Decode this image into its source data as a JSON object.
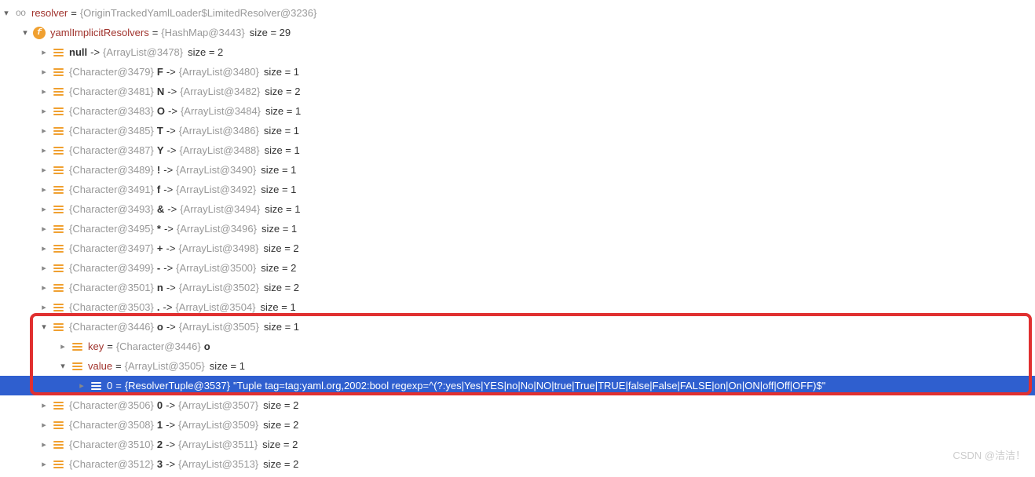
{
  "root": {
    "name": "resolver",
    "value": "{OriginTrackedYamlLoader$LimitedResolver@3236}"
  },
  "field": {
    "name": "yamlImplicitResolvers",
    "value": "{HashMap@3443}",
    "size": "size = 29"
  },
  "entries": [
    {
      "keyObj": "",
      "keyName": "null",
      "arrow": "->",
      "valObj": "{ArrayList@3478}",
      "size": "size = 2"
    },
    {
      "keyObj": "{Character@3479}",
      "keyName": "F",
      "arrow": "->",
      "valObj": "{ArrayList@3480}",
      "size": "size = 1"
    },
    {
      "keyObj": "{Character@3481}",
      "keyName": "N",
      "arrow": "->",
      "valObj": "{ArrayList@3482}",
      "size": "size = 2"
    },
    {
      "keyObj": "{Character@3483}",
      "keyName": "O",
      "arrow": "->",
      "valObj": "{ArrayList@3484}",
      "size": "size = 1"
    },
    {
      "keyObj": "{Character@3485}",
      "keyName": "T",
      "arrow": "->",
      "valObj": "{ArrayList@3486}",
      "size": "size = 1"
    },
    {
      "keyObj": "{Character@3487}",
      "keyName": "Y",
      "arrow": "->",
      "valObj": "{ArrayList@3488}",
      "size": "size = 1"
    },
    {
      "keyObj": "{Character@3489}",
      "keyName": "!",
      "arrow": "->",
      "valObj": "{ArrayList@3490}",
      "size": "size = 1"
    },
    {
      "keyObj": "{Character@3491}",
      "keyName": "f",
      "arrow": "->",
      "valObj": "{ArrayList@3492}",
      "size": "size = 1"
    },
    {
      "keyObj": "{Character@3493}",
      "keyName": "&",
      "arrow": "->",
      "valObj": "{ArrayList@3494}",
      "size": "size = 1"
    },
    {
      "keyObj": "{Character@3495}",
      "keyName": "*",
      "arrow": "->",
      "valObj": "{ArrayList@3496}",
      "size": "size = 1"
    },
    {
      "keyObj": "{Character@3497}",
      "keyName": "+",
      "arrow": "->",
      "valObj": "{ArrayList@3498}",
      "size": "size = 2"
    },
    {
      "keyObj": "{Character@3499}",
      "keyName": "-",
      "arrow": "->",
      "valObj": "{ArrayList@3500}",
      "size": "size = 2"
    },
    {
      "keyObj": "{Character@3501}",
      "keyName": "n",
      "arrow": "->",
      "valObj": "{ArrayList@3502}",
      "size": "size = 2"
    },
    {
      "keyObj": "{Character@3503}",
      "keyName": ".",
      "arrow": "->",
      "valObj": "{ArrayList@3504}",
      "size": "size = 1"
    }
  ],
  "expanded": {
    "keyObj": "{Character@3446}",
    "keyName": "o",
    "arrow": "->",
    "valObj": "{ArrayList@3505}",
    "size": "size = 1",
    "key": {
      "label": "key",
      "value": "{Character@3446}",
      "char": "o"
    },
    "value": {
      "label": "value",
      "obj": "{ArrayList@3505}",
      "size": "size = 1"
    },
    "item": {
      "index": "0",
      "obj": "{ResolverTuple@3537}",
      "str": "\"Tuple tag=tag:yaml.org,2002:bool regexp=^(?:yes|Yes|YES|no|No|NO|true|True|TRUE|false|False|FALSE|on|On|ON|off|Off|OFF)$\""
    }
  },
  "after": [
    {
      "keyObj": "{Character@3506}",
      "keyName": "0",
      "arrow": "->",
      "valObj": "{ArrayList@3507}",
      "size": "size = 2"
    },
    {
      "keyObj": "{Character@3508}",
      "keyName": "1",
      "arrow": "->",
      "valObj": "{ArrayList@3509}",
      "size": "size = 2"
    },
    {
      "keyObj": "{Character@3510}",
      "keyName": "2",
      "arrow": "->",
      "valObj": "{ArrayList@3511}",
      "size": "size = 2"
    },
    {
      "keyObj": "{Character@3512}",
      "keyName": "3",
      "arrow": "->",
      "valObj": "{ArrayList@3513}",
      "size": "size = 2"
    }
  ],
  "watermark": "CSDN @洁洁！"
}
